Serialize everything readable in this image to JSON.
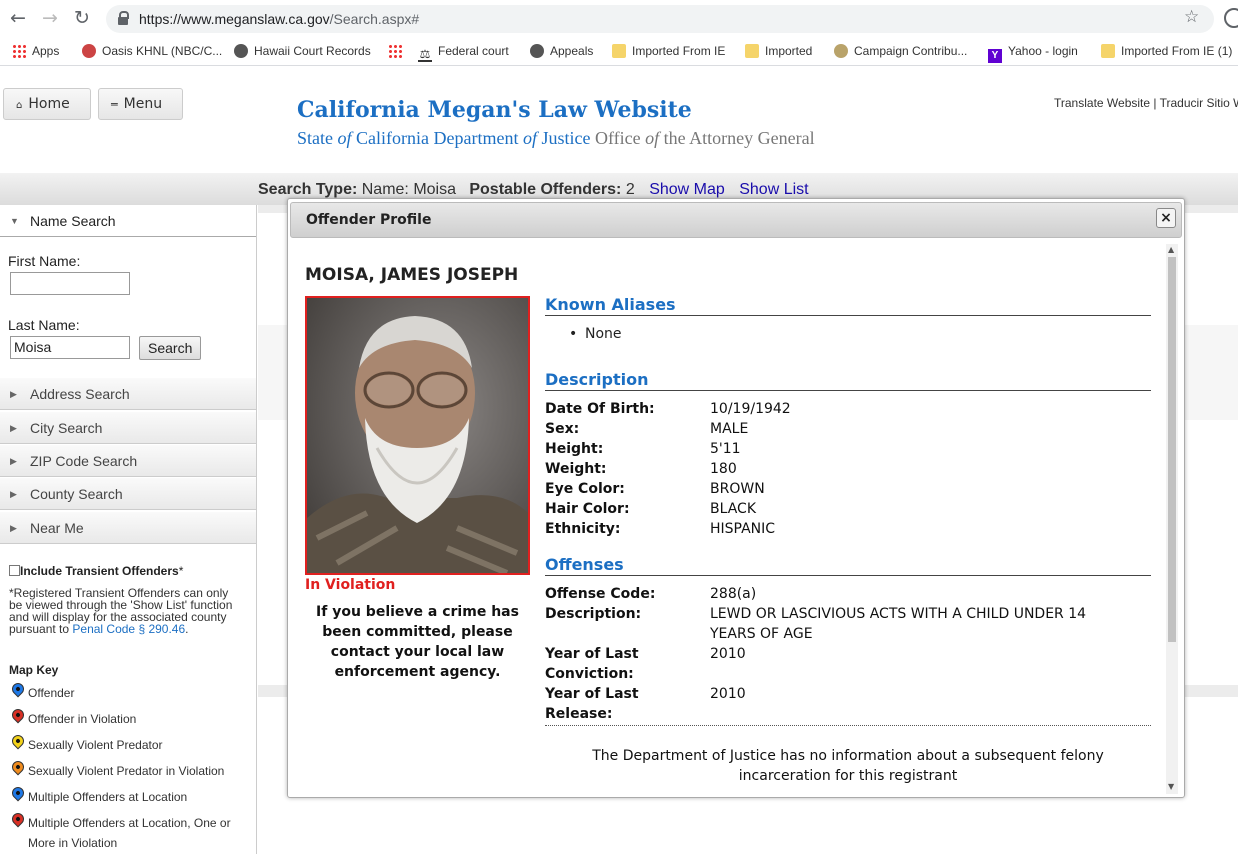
{
  "browser": {
    "url_host": "https://www.meganslaw.ca.gov",
    "url_path": "/Search.aspx#",
    "bookmarks": [
      "Apps",
      "Oasis KHNL (NBC/C...",
      "Hawaii Court Records",
      "",
      "Federal court",
      "Appeals",
      "Imported From IE",
      "Imported",
      "Campaign Contribu...",
      "Yahoo - login",
      "Imported From IE (1)"
    ]
  },
  "header": {
    "home_label": "Home",
    "menu_label": "Menu",
    "title": "California Megan's Law Website",
    "sub_state": "State",
    "sub_of1": "of",
    "sub_dept": "California Department",
    "sub_of2": "of",
    "sub_justice": "Justice",
    "sub_office": "Office",
    "sub_of3": "of",
    "sub_ag": "the Attorney General",
    "translate": "Translate Website | Traducir Sitio W"
  },
  "searchbar": {
    "type_label": "Search Type:",
    "type_value": "Name: Moisa",
    "postable_label": "Postable Offenders:",
    "postable_value": "2",
    "show_map": "Show Map",
    "show_list": "Show List"
  },
  "sidebar": {
    "name_search": "Name Search",
    "first_name_label": "First Name:",
    "first_name_value": "",
    "last_name_label": "Last Name:",
    "last_name_value": "Moisa",
    "search_btn": "Search",
    "sections": [
      "Address Search",
      "City Search",
      "ZIP Code Search",
      "County Search",
      "Near Me"
    ],
    "transient_label": "Include Transient Offenders",
    "transient_star": "*",
    "note_1": "*Registered Transient Offenders can only",
    "note_2": "be viewed through the 'Show List' function",
    "note_3": "and will display for the associated county",
    "note_4": "pursuant to",
    "note_link": "Penal Code § 290.46",
    "note_end": ".",
    "map_key_title": "Map Key",
    "map_key": [
      {
        "label": "Offender",
        "color": "#1e78e6"
      },
      {
        "label": "Offender in Violation",
        "color": "#d93025"
      },
      {
        "label": "Sexually Violent Predator",
        "color": "#f2d21b"
      },
      {
        "label": "Sexually Violent Predator in Violation",
        "color": "#f08c1e"
      },
      {
        "label": "Multiple Offenders at Location",
        "color": "#1e78e6"
      },
      {
        "label": "Multiple Offenders at Location, One or",
        "color": "#d93025"
      },
      {
        "label": "More in Violation",
        "color": ""
      }
    ]
  },
  "modal": {
    "title": "Offender Profile",
    "close": "×",
    "name": "MOISA, JAMES JOSEPH",
    "status": "In Violation",
    "advice": "If you believe a crime has been committed, please contact your local law enforcement agency.",
    "aliases_title": "Known Aliases",
    "aliases": [
      "None"
    ],
    "description_title": "Description",
    "description": [
      {
        "k": "Date Of Birth:",
        "v": "10/19/1942"
      },
      {
        "k": "Sex:",
        "v": "MALE"
      },
      {
        "k": "Height:",
        "v": "5'11"
      },
      {
        "k": "Weight:",
        "v": "180"
      },
      {
        "k": "Eye Color:",
        "v": "BROWN"
      },
      {
        "k": "Hair Color:",
        "v": "BLACK"
      },
      {
        "k": "Ethnicity:",
        "v": "HISPANIC"
      }
    ],
    "offenses_title": "Offenses",
    "offense_code_label": "Offense Code:",
    "offense_code": "288(a)",
    "offense_desc_label": "Description:",
    "offense_desc": "LEWD OR LASCIVIOUS ACTS WITH A CHILD UNDER 14 YEARS OF AGE",
    "conviction_label": "Year of Last Conviction:",
    "conviction_year": "2010",
    "release_label": "Year of Last Release:",
    "release_year": "2010",
    "footnote": "The Department of Justice has no information about a subsequent felony incarceration for this registrant"
  }
}
